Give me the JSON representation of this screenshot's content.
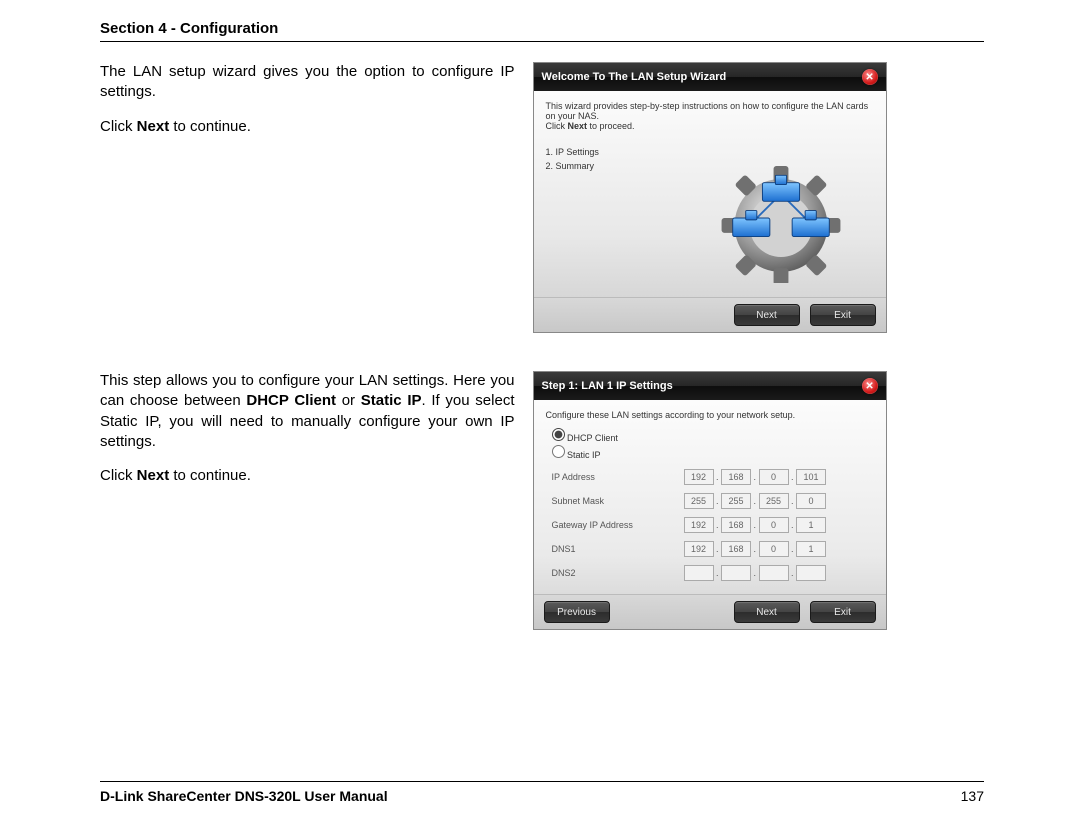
{
  "header": {
    "title": "Section 4 - Configuration"
  },
  "block1": {
    "p1": "The LAN setup wizard gives you the option to configure IP settings.",
    "p2_a": "Click ",
    "p2_b": "Next",
    "p2_c": " to continue."
  },
  "wiz1": {
    "title": "Welcome To The LAN Setup Wizard",
    "intro_a": "This wizard provides step-by-step instructions on how to configure the LAN cards on your NAS.",
    "intro_b1": "Click ",
    "intro_b2": "Next",
    "intro_b3": " to proceed.",
    "step1": "1. IP Settings",
    "step2": "2. Summary",
    "next": "Next",
    "exit": "Exit"
  },
  "block2": {
    "p1_a": "This step allows you to configure your LAN settings. Here you can choose between ",
    "p1_b": "DHCP Client",
    "p1_c": " or ",
    "p1_d": "Static IP",
    "p1_e": ". If you select Static IP, you will need to manually configure your own IP settings.",
    "p2_a": "Click ",
    "p2_b": "Next",
    "p2_c": " to continue."
  },
  "wiz2": {
    "title": "Step 1: LAN 1 IP Settings",
    "intro": "Configure these LAN settings according to your network setup.",
    "dhcp_label": "DHCP Client",
    "static_label": "Static IP",
    "rows": {
      "ip": {
        "label": "IP Address",
        "a": "192",
        "b": "168",
        "c": "0",
        "d": "101"
      },
      "mask": {
        "label": "Subnet Mask",
        "a": "255",
        "b": "255",
        "c": "255",
        "d": "0"
      },
      "gw": {
        "label": "Gateway IP Address",
        "a": "192",
        "b": "168",
        "c": "0",
        "d": "1"
      },
      "dns1": {
        "label": "DNS1",
        "a": "192",
        "b": "168",
        "c": "0",
        "d": "1"
      },
      "dns2": {
        "label": "DNS2",
        "a": "",
        "b": "",
        "c": "",
        "d": ""
      }
    },
    "prev": "Previous",
    "next": "Next",
    "exit": "Exit"
  },
  "footer": {
    "left": "D-Link ShareCenter DNS-320L User Manual",
    "page": "137"
  }
}
